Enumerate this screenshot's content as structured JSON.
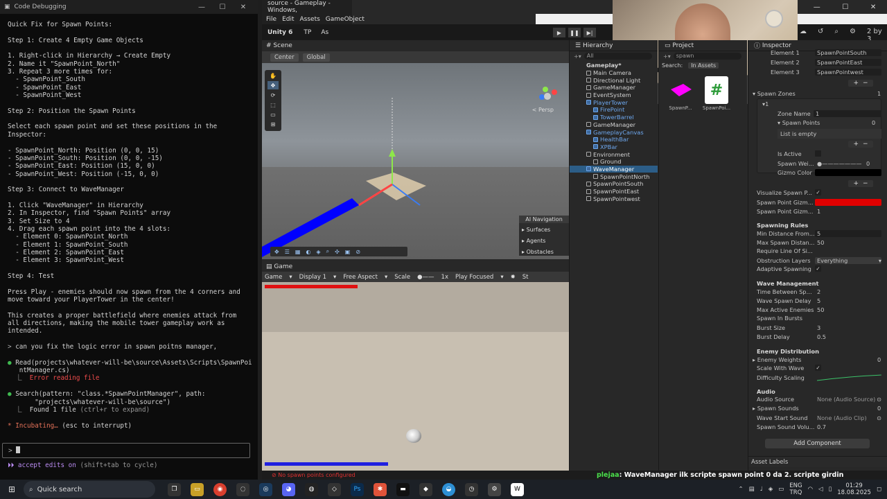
{
  "terminal": {
    "title": "Code Debugging",
    "lines": [
      "Quick Fix for Spawn Points:",
      "",
      "Step 1: Create 4 Empty Game Objects",
      "",
      "1. Right-click in Hierarchy → Create Empty",
      "2. Name it \"SpawnPoint_North\"",
      "3. Repeat 3 more times for:",
      "  - SpawnPoint_South",
      "  - SpawnPoint_East",
      "  - SpawnPoint_West",
      "",
      "Step 2: Position the Spawn Points",
      "",
      "Select each spawn point and set these positions in the",
      "Inspector:",
      "",
      "- SpawnPoint_North: Position (0, 0, 15)",
      "- SpawnPoint_South: Position (0, 0, -15)",
      "- SpawnPoint_East: Position (15, 0, 0)",
      "- SpawnPoint_West: Position (-15, 0, 0)",
      "",
      "Step 3: Connect to WaveManager",
      "",
      "1. Click \"WaveManager\" in Hierarchy",
      "2. In Inspector, find \"Spawn Points\" array",
      "3. Set Size to 4",
      "4. Drag each spawn point into the 4 slots:",
      "  - Element 0: SpawnPoint_North",
      "  - Element 1: SpawnPoint_South",
      "  - Element 2: SpawnPoint_East",
      "  - Element 3: SpawnPoint_West",
      "",
      "Step 4: Test",
      "",
      "Press Play - enemies should now spawn from the 4 corners and",
      "move toward your PlayerTower in the center!",
      "",
      "This creates a proper battlefield where enemies attack from",
      "all directions, making the mobile tower gameplay work as",
      "intended."
    ],
    "user_msg": "can you fix the logic error in spawn poitns manager,",
    "read_call": "Read(projects\\whatever-will-be\\source\\Assets\\Scripts\\SpawnPoi",
    "read_call2": "   ntManager.cs)",
    "read_err": "Error reading file",
    "search_call": "Search(pattern: \"class.*SpawnPointManager\", path:",
    "search_call2": "       \"projects\\whatever-will-be\\source\")",
    "search_result": "Found 1 file",
    "search_hint": "(ctrl+r to expand)",
    "incubating": "Incubating…",
    "interrupt": "(esc to interrupt)",
    "prompt_symbol": ">",
    "accept_text": "accept edits on",
    "accept_hint": "(shift+tab to cycle)"
  },
  "unity": {
    "title": "source - Gameplay - Windows,",
    "menu": [
      "File",
      "Edit",
      "Assets",
      "GameObject"
    ],
    "version": "Unity 6",
    "tp": "TP",
    "account": "As",
    "layers": "2 by 3",
    "scene_tab": "Scene",
    "pivot": "Center",
    "space": "Global",
    "persp": "< Persp",
    "ai_nav": {
      "title": "AI Navigation",
      "items": [
        "Surfaces",
        "Agents",
        "Obstacles"
      ]
    },
    "game_tab": "Game",
    "game_bar": {
      "display_mode": "Game",
      "display": "Display 1",
      "aspect": "Free Aspect",
      "scale_label": "Scale",
      "scale_value": "1x",
      "play_mode": "Play Focused",
      "stats": "St"
    },
    "status_error": "No spawn points configured",
    "chat_name": "plejaa",
    "chat_msg": "WaveManager ilk scripte spawn point 0 da 2. scripte girdin"
  },
  "hierarchy": {
    "tab": "Hierarchy",
    "search_placeholder": "All",
    "items": [
      {
        "label": "Gameplay*",
        "indent": 0,
        "kind": "scene"
      },
      {
        "label": "Main Camera",
        "indent": 1,
        "kind": "obj"
      },
      {
        "label": "Directional Light",
        "indent": 1,
        "kind": "obj"
      },
      {
        "label": "GameManager",
        "indent": 1,
        "kind": "obj"
      },
      {
        "label": "EventSystem",
        "indent": 1,
        "kind": "obj"
      },
      {
        "label": "PlayerTower",
        "indent": 1,
        "kind": "prefab"
      },
      {
        "label": "FirePoint",
        "indent": 2,
        "kind": "prefab"
      },
      {
        "label": "TowerBarrel",
        "indent": 2,
        "kind": "prefab"
      },
      {
        "label": "GameManager",
        "indent": 1,
        "kind": "obj"
      },
      {
        "label": "GameplayCanvas",
        "indent": 1,
        "kind": "prefab"
      },
      {
        "label": "HealthBar",
        "indent": 2,
        "kind": "prefab"
      },
      {
        "label": "XPBar",
        "indent": 2,
        "kind": "prefab"
      },
      {
        "label": "Environment",
        "indent": 1,
        "kind": "obj"
      },
      {
        "label": "Ground",
        "indent": 2,
        "kind": "obj"
      },
      {
        "label": "WaveManager",
        "indent": 1,
        "kind": "selected"
      },
      {
        "label": "SpawnPointNorth",
        "indent": 2,
        "kind": "obj"
      },
      {
        "label": "SpawnPointSouth",
        "indent": 1,
        "kind": "obj"
      },
      {
        "label": "SpawnPointEast",
        "indent": 1,
        "kind": "obj"
      },
      {
        "label": "SpawnPointwest",
        "indent": 1,
        "kind": "obj"
      }
    ]
  },
  "project": {
    "tab": "Project",
    "search_value": "spawn",
    "search_label": "Search:",
    "search_scope": "In Assets",
    "assets": [
      {
        "label": "SpawnP...",
        "color": "#ff00ff"
      },
      {
        "label": "SpawnPoi...",
        "color": "#ffffff"
      }
    ]
  },
  "inspector": {
    "tab": "Inspector",
    "elements": [
      {
        "label": "Element 1",
        "value": "SpawnPointSouth"
      },
      {
        "label": "Element 2",
        "value": "SpawnPointEast"
      },
      {
        "label": "Element 3",
        "value": "SpawnPointwest"
      }
    ],
    "spawn_zones": {
      "label": "Spawn Zones",
      "count": "1",
      "item_label": "1",
      "zone_name_label": "Zone Name",
      "zone_name": "1",
      "spawn_points_label": "Spawn Points",
      "spawn_points_count": "0",
      "empty_text": "List is empty",
      "is_active_label": "Is Active",
      "spawn_weight_label": "Spawn Wei...",
      "spawn_weight": "0",
      "gizmo_color_label": "Gizmo Color"
    },
    "visualize_label": "Visualize Spawn P...",
    "gizmo_color_label": "Spawn Point Gizm...",
    "gizmo_size_label": "Spawn Point Gizm...",
    "gizmo_size": "1",
    "spawning_rules": {
      "header": "Spawning Rules",
      "min_dist_label": "Min Distance From...",
      "min_dist": "5",
      "max_dist_label": "Max Spawn Distan...",
      "max_dist": "50",
      "line_of_sight_label": "Require Line Of Si...",
      "obstruction_label": "Obstruction Layers",
      "obstruction": "Everything",
      "adaptive_label": "Adaptive Spawning"
    },
    "wave_management": {
      "header": "Wave Management",
      "rows": [
        {
          "label": "Time Between Spa...",
          "value": "2"
        },
        {
          "label": "Wave Spawn Delay",
          "value": "5"
        },
        {
          "label": "Max Active Enemies",
          "value": "50"
        },
        {
          "label": "Spawn In Bursts",
          "value": ""
        },
        {
          "label": "Burst Size",
          "value": "3"
        },
        {
          "label": "Burst Delay",
          "value": "0.5"
        }
      ]
    },
    "enemy_distribution": {
      "header": "Enemy Distribution",
      "weights_label": "Enemy Weights",
      "weights_count": "0",
      "scale_label": "Scale With Wave",
      "difficulty_label": "Difficulty Scaling"
    },
    "audio": {
      "header": "Audio",
      "source_label": "Audio Source",
      "source": "None (Audio Source)",
      "sounds_label": "Spawn Sounds",
      "sounds_count": "0",
      "wave_sound_label": "Wave Start Sound",
      "wave_sound": "None (Audio Clip)",
      "volume_label": "Spawn Sound Volu...",
      "volume": "0.7"
    },
    "add_component": "Add Component",
    "asset_labels": "Asset Labels"
  },
  "taskbar": {
    "search": "Quick search",
    "lang": "ENG",
    "lang2": "TRQ",
    "time": "01:29",
    "date": "18.08.2025"
  },
  "colors": {
    "gizmo_red": "#e00000",
    "selection": "#2c5d87",
    "prefab_blue": "#6ea8ef"
  }
}
